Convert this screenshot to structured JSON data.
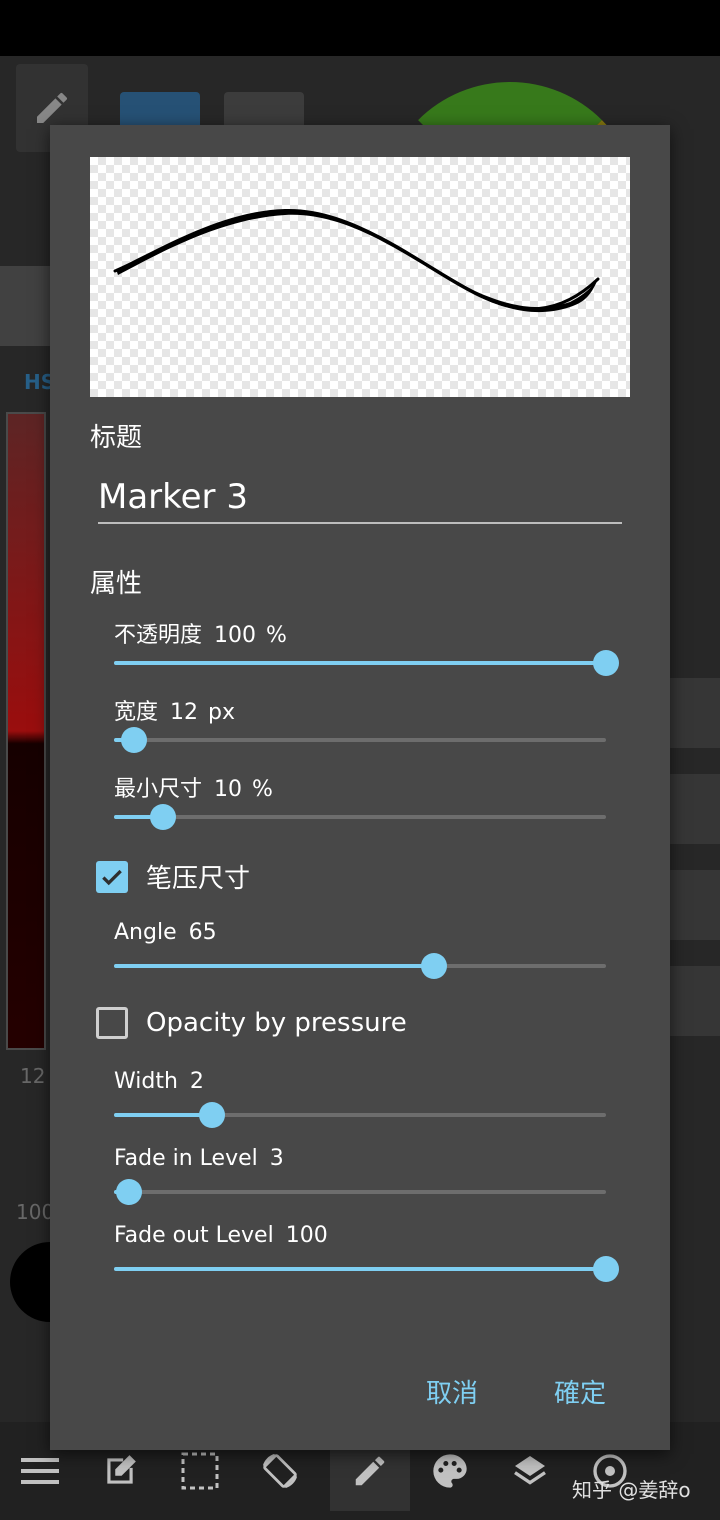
{
  "background": {
    "bg_label_hs": "HS",
    "bg_value_12": "12",
    "bg_value_100": "100",
    "watermark": "知乎 @姜辞o"
  },
  "dialog": {
    "title_section": "标题",
    "title_value": "Marker 3",
    "properties_section": "属性",
    "sliders": [
      {
        "label": "不透明度",
        "value": "100",
        "unit": "%",
        "fraction": 1.0
      },
      {
        "label": "宽度",
        "value": "12",
        "unit": "px",
        "fraction": 0.04
      },
      {
        "label": "最小尺寸",
        "value": "10",
        "unit": "%",
        "fraction": 0.1
      },
      {
        "label": "Angle",
        "value": "65",
        "unit": "",
        "fraction": 0.65
      },
      {
        "label": "Width",
        "value": "2",
        "unit": "",
        "fraction": 0.2
      },
      {
        "label": "Fade in Level",
        "value": "3",
        "unit": "",
        "fraction": 0.03
      },
      {
        "label": "Fade out Level",
        "value": "100",
        "unit": "",
        "fraction": 1.0
      }
    ],
    "pressure_size": {
      "label": "笔压尺寸",
      "checked": true
    },
    "opacity_by_pressure": {
      "label": "Opacity by pressure",
      "checked": false
    },
    "cancel_label": "取消",
    "ok_label": "確定"
  },
  "colors": {
    "accent": "#7fcff2",
    "dialog_bg": "#484848",
    "track": "#6d6d6d"
  },
  "icons": {
    "toolbar": [
      "menu-icon",
      "edit-icon",
      "selection-icon",
      "rotate-icon",
      "pencil-icon",
      "palette-icon",
      "layers-icon",
      "settings-icon"
    ]
  }
}
